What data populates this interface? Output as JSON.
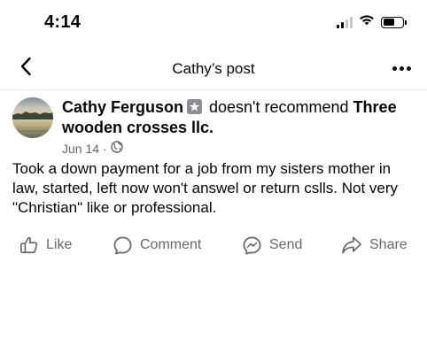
{
  "status_bar": {
    "time": "4:14",
    "signal_bars_active": 2,
    "battery_level": 0.6
  },
  "nav": {
    "title": "Cathy’s post",
    "back_icon": "chevron-left-icon",
    "more_icon": "more-horizontal-icon"
  },
  "post": {
    "author": "Cathy Ferguson",
    "badge_icon": "star-badge-icon",
    "verb": "doesn't recommend",
    "page_name": "Three wooden crosses llc.",
    "date": "Jun 14",
    "separator": "·",
    "privacy_icon": "globe-icon",
    "body": "Took a down payment for a job from my sisters mother in law, started,  left now won't answel or return cslls. Not very   \"Christian\" like or professional."
  },
  "actions": {
    "like_label": "Like",
    "comment_label": "Comment",
    "send_label": "Send",
    "share_label": "Share"
  },
  "colors": {
    "text_primary": "#050505",
    "text_secondary": "#65676b",
    "divider": "#e4e6eb"
  }
}
